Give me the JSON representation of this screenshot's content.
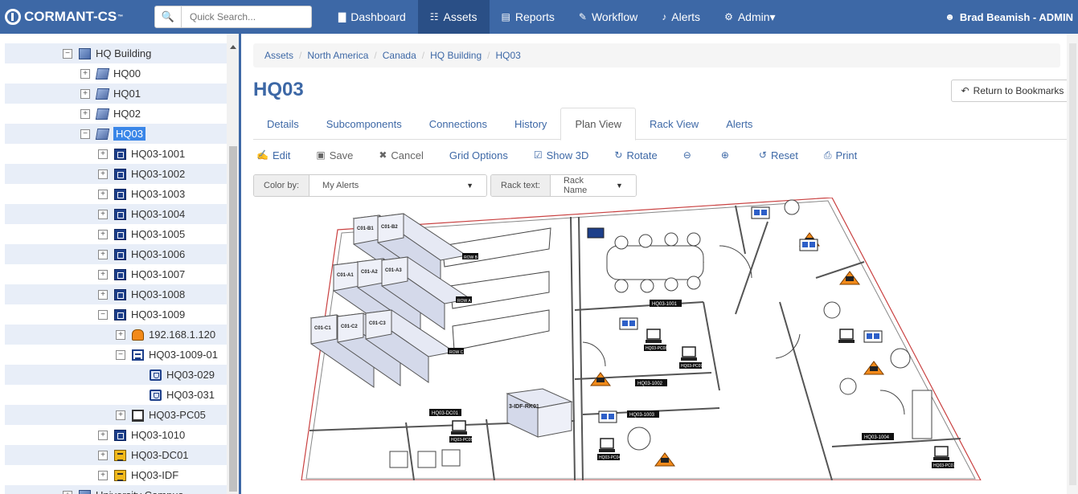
{
  "navbar": {
    "brand": "CORMANT-CS",
    "brand_mark": "™",
    "search_placeholder": "Quick Search...",
    "items": [
      {
        "label": "Dashboard",
        "icon": "bar-chart-icon"
      },
      {
        "label": "Assets",
        "icon": "sitemap-icon",
        "active": true
      },
      {
        "label": "Reports",
        "icon": "file-icon"
      },
      {
        "label": "Workflow",
        "icon": "pencil-icon"
      },
      {
        "label": "Alerts",
        "icon": "bell-icon"
      },
      {
        "label": "Admin",
        "icon": "gears-icon",
        "dropdown": true
      }
    ],
    "user": "Brad Beamish - ADMIN"
  },
  "tree": [
    {
      "label": "HQ Building",
      "level": 0,
      "icon": "building",
      "toggle": "−",
      "alt": true
    },
    {
      "label": "HQ00",
      "level": 1,
      "icon": "floor",
      "toggle": "+"
    },
    {
      "label": "HQ01",
      "level": 1,
      "icon": "floor",
      "toggle": "+",
      "alt": true
    },
    {
      "label": "HQ02",
      "level": 1,
      "icon": "floor",
      "toggle": "+"
    },
    {
      "label": "HQ03",
      "level": 1,
      "icon": "floor",
      "toggle": "−",
      "alt": true,
      "selected": true
    },
    {
      "label": "HQ03-1001",
      "level": 2,
      "icon": "room",
      "toggle": "+"
    },
    {
      "label": "HQ03-1002",
      "level": 2,
      "icon": "room",
      "toggle": "+",
      "alt": true
    },
    {
      "label": "HQ03-1003",
      "level": 2,
      "icon": "room",
      "toggle": "+"
    },
    {
      "label": "HQ03-1004",
      "level": 2,
      "icon": "room",
      "toggle": "+",
      "alt": true
    },
    {
      "label": "HQ03-1005",
      "level": 2,
      "icon": "room",
      "toggle": "+"
    },
    {
      "label": "HQ03-1006",
      "level": 2,
      "icon": "room",
      "toggle": "+",
      "alt": true
    },
    {
      "label": "HQ03-1007",
      "level": 2,
      "icon": "room",
      "toggle": "+"
    },
    {
      "label": "HQ03-1008",
      "level": 2,
      "icon": "room",
      "toggle": "+",
      "alt": true
    },
    {
      "label": "HQ03-1009",
      "level": 2,
      "icon": "room",
      "toggle": "−"
    },
    {
      "label": "192.168.1.120",
      "level": 3,
      "icon": "phone",
      "toggle": "+",
      "alt": true
    },
    {
      "label": "HQ03-1009-01",
      "level": 3,
      "icon": "rack",
      "toggle": "−"
    },
    {
      "label": "HQ03-029",
      "level": 4,
      "icon": "port",
      "toggle": "",
      "alt": true
    },
    {
      "label": "HQ03-031",
      "level": 4,
      "icon": "port",
      "toggle": ""
    },
    {
      "label": "HQ03-PC05",
      "level": 3,
      "icon": "pc",
      "toggle": "+",
      "alt": true
    },
    {
      "label": "HQ03-1010",
      "level": 2,
      "icon": "room",
      "toggle": "+"
    },
    {
      "label": "HQ03-DC01",
      "level": 2,
      "icon": "dc",
      "toggle": "+",
      "alt": true
    },
    {
      "label": "HQ03-IDF",
      "level": 2,
      "icon": "dc",
      "toggle": "+"
    },
    {
      "label": "University Campus",
      "level": 0,
      "icon": "building",
      "toggle": "+",
      "alt": true
    }
  ],
  "breadcrumb": [
    "Assets",
    "North America",
    "Canada",
    "HQ Building",
    "HQ03"
  ],
  "page_title": "HQ03",
  "bookmark_button": "Return to Bookmarks",
  "tabs": [
    {
      "label": "Details"
    },
    {
      "label": "Subcomponents"
    },
    {
      "label": "Connections"
    },
    {
      "label": "History"
    },
    {
      "label": "Plan View",
      "active": true
    },
    {
      "label": "Rack View"
    },
    {
      "label": "Alerts"
    }
  ],
  "toolbar": [
    {
      "label": "Edit",
      "icon": "edit-icon"
    },
    {
      "label": "Save",
      "icon": "save-icon",
      "grey": true
    },
    {
      "label": "Cancel",
      "icon": "times-icon",
      "grey": true
    },
    {
      "label": "Grid Options",
      "icon": ""
    },
    {
      "label": "Show 3D",
      "icon": "check-square-icon"
    },
    {
      "label": "Rotate",
      "icon": "rotate-icon"
    },
    {
      "label": "",
      "icon": "zoom-out-icon"
    },
    {
      "label": "",
      "icon": "zoom-in-icon"
    },
    {
      "label": "Reset",
      "icon": "undo-icon"
    },
    {
      "label": "Print",
      "icon": "print-icon"
    }
  ],
  "color_by": {
    "label": "Color by:",
    "value": "My Alerts"
  },
  "rack_text": {
    "label": "Rack text:",
    "value": "Rack Name"
  },
  "plan": {
    "racks": [
      "C01-B1",
      "C01-B2",
      "C01-A1",
      "C01-A2",
      "C01-A3",
      "C01-C1",
      "C01-C2",
      "C01-C3"
    ],
    "row_labels": [
      "ROW B",
      "ROW A",
      "ROW C"
    ],
    "idf_label": "3-IDF-RK01",
    "room_labels": [
      "HQ03-1001",
      "HQ03-1002",
      "HQ03-1003",
      "HQ03-DC01",
      "HQ03-1004"
    ],
    "device_labels": [
      "HQ03-PC08",
      "HQ03-PC09",
      "HQ03-PC05",
      "HQ03-PC04",
      "HQ03-PC07"
    ]
  }
}
